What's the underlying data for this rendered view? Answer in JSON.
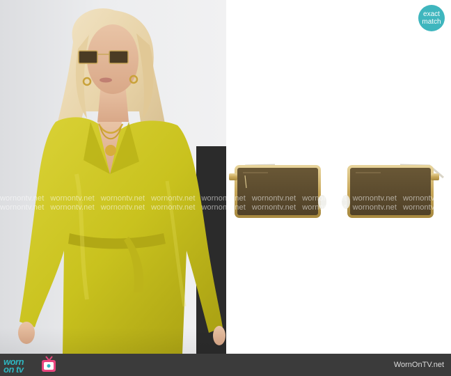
{
  "match_badge": {
    "line1": "exact",
    "line2": "match"
  },
  "watermark": {
    "text": "wornontv.net"
  },
  "footer": {
    "logo_worn": "worn",
    "logo_ontv": "on tv",
    "site_name": "WornOnTV.net"
  },
  "colors": {
    "accent": "#3fb6be",
    "footer_bg": "#3b3b3b",
    "jacket": "#c9c21e",
    "lens": "#5b4a2e",
    "frame": "#c9a85a"
  },
  "icons": {
    "tv": "tv-icon"
  }
}
